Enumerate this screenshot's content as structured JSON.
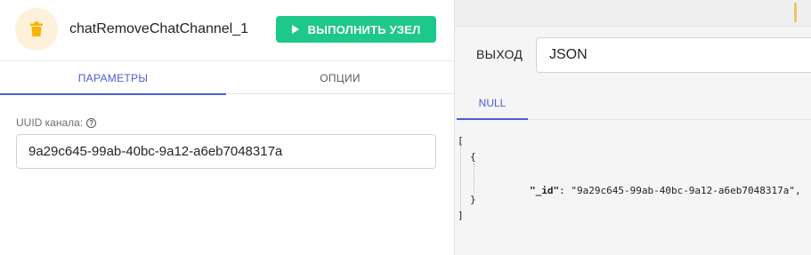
{
  "node": {
    "title": "chatRemoveChatChannel_1",
    "icon": "trash-icon",
    "run_button_label": "ВЫПОЛНИТЬ УЗЕЛ"
  },
  "left_tabs": [
    {
      "label": "ПАРАМЕТРЫ",
      "active": true
    },
    {
      "label": "ОПЦИИ",
      "active": false
    }
  ],
  "params": {
    "channel_uuid_label": "UUID канала:",
    "channel_uuid_value": "9a29c645-99ab-40bc-9a12-a6eb7048317a"
  },
  "output": {
    "label": "ВЫХОД",
    "format": "JSON",
    "tabs": [
      {
        "label": "NULL",
        "active": true
      }
    ]
  },
  "json_output": {
    "open_bracket": "[",
    "open_brace": "{",
    "key": "\"_id\"",
    "colon": ": ",
    "value": "\"9a29c645-99ab-40bc-9a12-a6eb7048317a\",",
    "close_brace": "}",
    "close_bracket": "]"
  },
  "colors": {
    "accent": "#4b5fd6",
    "run_button": "#1ec88a",
    "icon": "#f5b400",
    "icon_bg": "#fdf2d9"
  }
}
